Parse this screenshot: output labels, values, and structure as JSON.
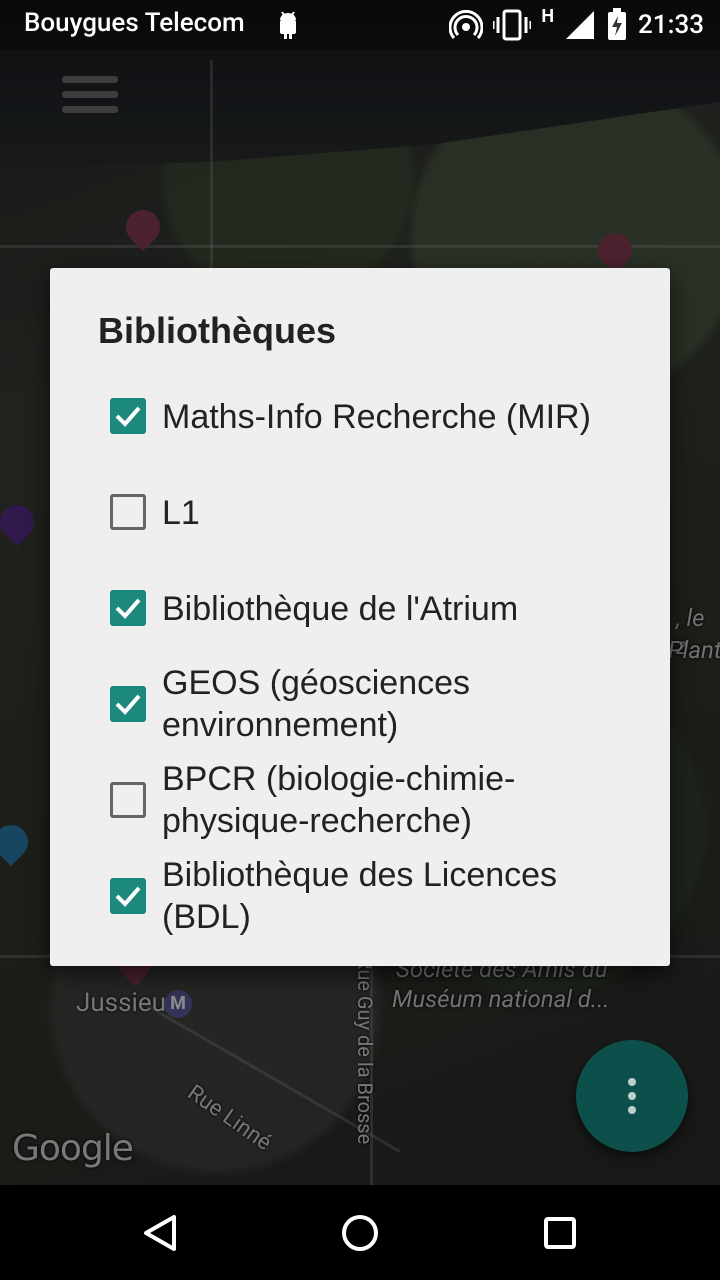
{
  "status_bar": {
    "carrier": "Bouygues Telecom",
    "network_type": "H",
    "time": "21:33"
  },
  "map": {
    "labels": {
      "jussieu": "Jussieu",
      "metro_symbol": "M",
      "rue_linne": "Rue Linné",
      "rue_guy_de_la_brosse": "Rue Guy de la Brosse",
      "societe_line1": "Société des Amis du",
      "societe_line2": "Muséum national d...",
      "right_edge_1": ", le z",
      "right_edge_2": "Plant",
      "google_logo": "Google"
    }
  },
  "dialog": {
    "title": "Bibliothèques",
    "items": [
      {
        "label": "Maths-Info Recherche (MIR)",
        "checked": true
      },
      {
        "label": "L1",
        "checked": false
      },
      {
        "label": "Bibliothèque de l'Atrium",
        "checked": true
      },
      {
        "label": "GEOS (géosciences environnement)",
        "checked": true
      },
      {
        "label": "BPCR (biologie-chimie-physique-recherche)",
        "checked": false
      },
      {
        "label": "Bibliothèque des Licences (BDL)",
        "checked": true
      }
    ]
  },
  "colors": {
    "accent": "#1b8a7d",
    "dialog_bg": "#efefef",
    "fab_bg": "#0d4f4a"
  }
}
